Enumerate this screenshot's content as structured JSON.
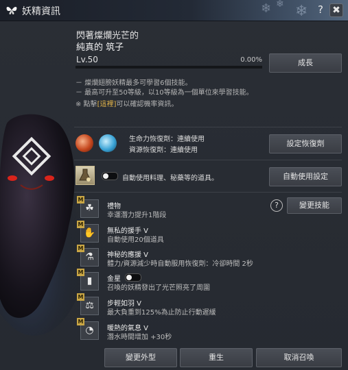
{
  "window": {
    "title": "妖精資訊",
    "help_glyph": "?",
    "close_glyph": "✖"
  },
  "fairy": {
    "title_line": "閃著燦爛光芒的",
    "name_line": "純真的 筑子",
    "level": "Lv.50",
    "exp_text": "0.00%",
    "exp_progress": 0.0
  },
  "info": {
    "line1": "－ 燦爛翅膀妖精最多可學習6個技能。",
    "line2": "－ 最高可升至50等級，以10等級為一個單位來學習技能。",
    "line3_prefix": "※ 點擊",
    "line3_link": "[這裡]",
    "line3_suffix": "可以確認機率資訊。"
  },
  "buttons": {
    "grow": "成長",
    "set_recovery": "設定恢復劑",
    "auto_use_settings": "自動使用設定",
    "change_skill": "變更技能",
    "change_appearance": "變更外型",
    "rebirth": "重生",
    "cancel_summon": "取消召喚"
  },
  "recovery": {
    "hp_label": "生命力恢復劑：連續使用",
    "mp_label": "資源恢復劑：連續使用"
  },
  "auto_use": {
    "label": "自動使用料理、秘藥等的道具。",
    "enabled": false
  },
  "skills": [
    {
      "name": "禮物",
      "desc": "幸運潛力提升1階段",
      "icon": "clover-icon"
    },
    {
      "name": "無私的援手 V",
      "desc": "自動使用20個道具",
      "icon": "fairy-hand-icon"
    },
    {
      "name": "神秘的應援 V",
      "desc": "體力/資源減少時自動服用恢復劑：冷卻時間 2秒",
      "icon": "potion-bag-icon"
    },
    {
      "name": "金星",
      "desc": "召喚的妖精發出了光芒照亮了周圍",
      "icon": "lamp-icon",
      "toggle": false
    },
    {
      "name": "步輕如羽 V",
      "desc": "最大負重到125%為止防止行動遲緩",
      "icon": "weight-icon"
    },
    {
      "name": "暖熱的氣息 V",
      "desc": "潛水時間增加 +30秒",
      "icon": "breath-icon"
    }
  ],
  "colors": {
    "accent_gold": "#d7b14c",
    "link": "#e8b84a"
  }
}
